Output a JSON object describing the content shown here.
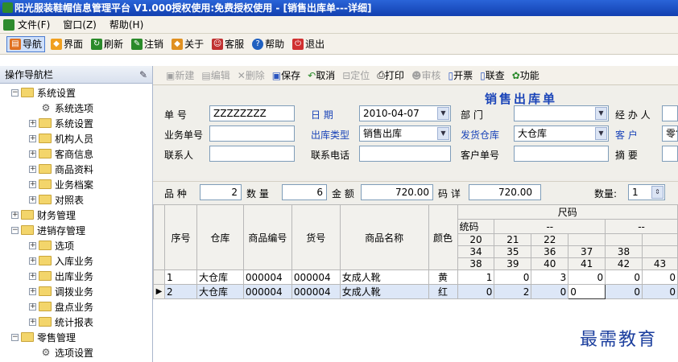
{
  "window": {
    "title": "阳光服装鞋帽信息管理平台  V1.000授权使用:免费授权使用 - [销售出库单---详细]"
  },
  "menu": {
    "items": [
      "文件(F)",
      "窗口(Z)",
      "帮助(H)"
    ]
  },
  "toolbar": {
    "items": [
      {
        "label": "导航",
        "icon": "navigation-icon",
        "color": "#e07020"
      },
      {
        "label": "界面",
        "icon": "interface-icon",
        "color": "#f0a020"
      },
      {
        "label": "刷新",
        "icon": "refresh-icon",
        "color": "#2a8a2a"
      },
      {
        "label": "注销",
        "icon": "logout-icon",
        "color": "#2a8a2a"
      },
      {
        "label": "关于",
        "icon": "about-icon",
        "color": "#e09020"
      },
      {
        "label": "客服",
        "icon": "service-icon",
        "color": "#c03030"
      },
      {
        "label": "帮助",
        "icon": "help-icon",
        "color": "#2060c0"
      },
      {
        "label": "退出",
        "icon": "exit-icon",
        "color": "#d03030"
      }
    ]
  },
  "sidebar": {
    "title": "操作导航栏",
    "tree": [
      {
        "label": "系统设置",
        "type": "folder",
        "expanded": true
      },
      {
        "label": "系统选项",
        "type": "leaf"
      },
      {
        "label": "系统设置",
        "type": "folder",
        "expanded": false
      },
      {
        "label": "机构人员",
        "type": "folder",
        "expanded": false
      },
      {
        "label": "客商信息",
        "type": "folder",
        "expanded": false
      },
      {
        "label": "商品资料",
        "type": "folder",
        "expanded": false
      },
      {
        "label": "业务档案",
        "type": "folder",
        "expanded": false
      },
      {
        "label": "对照表",
        "type": "folder",
        "expanded": false
      },
      {
        "label": "财务管理",
        "type": "folder",
        "expanded": false
      },
      {
        "label": "进销存管理",
        "type": "folder",
        "expanded": true
      },
      {
        "label": "选项",
        "type": "folder",
        "expanded": false
      },
      {
        "label": "入库业务",
        "type": "folder",
        "expanded": false
      },
      {
        "label": "出库业务",
        "type": "folder",
        "expanded": false
      },
      {
        "label": "调拨业务",
        "type": "folder",
        "expanded": false
      },
      {
        "label": "盘点业务",
        "type": "folder",
        "expanded": false
      },
      {
        "label": "统计报表",
        "type": "folder",
        "expanded": false
      },
      {
        "label": "零售管理",
        "type": "folder",
        "expanded": true
      },
      {
        "label": "选项设置",
        "type": "leaf"
      }
    ]
  },
  "subtoolbar": {
    "items": [
      {
        "label": "新建",
        "enabled": false
      },
      {
        "label": "编辑",
        "enabled": false
      },
      {
        "label": "删除",
        "enabled": false
      },
      {
        "label": "保存",
        "enabled": true
      },
      {
        "label": "取消",
        "enabled": true
      },
      {
        "label": "定位",
        "enabled": false
      },
      {
        "label": "打印",
        "enabled": true
      },
      {
        "label": "审核",
        "enabled": false
      },
      {
        "label": "开票",
        "enabled": true
      },
      {
        "label": "联查",
        "enabled": true
      },
      {
        "label": "功能",
        "enabled": true
      }
    ]
  },
  "form": {
    "title": "销售出库单",
    "doc_no_label": "单 号",
    "doc_no": "ZZZZZZZZ",
    "date_label": "日 期",
    "date": "2010-04-07",
    "dept_label": "部 门",
    "dept": "",
    "handler_label": "经 办 人",
    "biz_no_label": "业务单号",
    "biz_no": "",
    "out_type_label": "出库类型",
    "out_type": "销售出库",
    "warehouse_label": "发货仓库",
    "warehouse": "大仓库",
    "customer_label": "客 户",
    "customer": "零售",
    "contact_label": "联系人",
    "contact": "",
    "phone_label": "联系电话",
    "phone": "",
    "cust_no_label": "客户单号",
    "cust_no": "",
    "summary_label": "摘 要"
  },
  "summary": {
    "variety_label": "品 种",
    "variety": "2",
    "qty_label": "数 量",
    "qty": "6",
    "amount_label": "金 额",
    "amount": "720.00",
    "code_label": "码 详",
    "code_value": "720.00",
    "count_label": "数量:",
    "count": "1"
  },
  "grid": {
    "headers": [
      "序号",
      "仓库",
      "商品编号",
      "货号",
      "商品名称",
      "颜色"
    ],
    "size_header": "尺码",
    "size_group": "统码",
    "dash": "--",
    "size_rows": [
      [
        "20",
        "21",
        "22",
        "",
        "",
        ""
      ],
      [
        "34",
        "35",
        "36",
        "37",
        "38",
        ""
      ],
      [
        "38",
        "39",
        "40",
        "41",
        "42",
        "43"
      ]
    ],
    "rows": [
      {
        "seq": "1",
        "warehouse": "大仓库",
        "code": "000004",
        "sku": "000004",
        "name": "女成人靴",
        "color": "黄",
        "sizes": [
          "1",
          "0",
          "3",
          "0",
          "0",
          "0"
        ]
      },
      {
        "seq": "2",
        "warehouse": "大仓库",
        "code": "000004",
        "sku": "000004",
        "name": "女成人靴",
        "color": "红",
        "sizes": [
          "0",
          "2",
          "0",
          "0",
          "0",
          "0"
        ]
      }
    ]
  },
  "watermark": "最需教育"
}
